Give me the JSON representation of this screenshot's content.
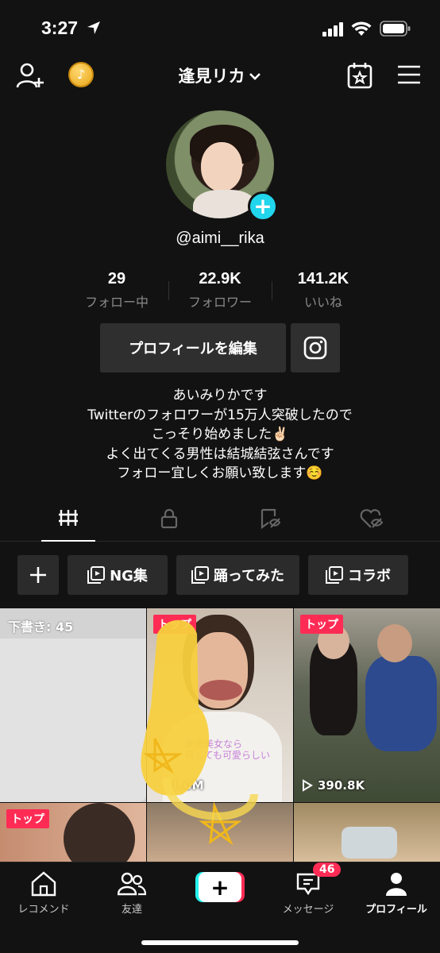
{
  "status_bar": {
    "time": "3:27"
  },
  "header": {
    "account_name": "逢見リカ"
  },
  "profile": {
    "username": "@aimi__rika",
    "stats": [
      {
        "value": "29",
        "label": "フォロー中"
      },
      {
        "value": "22.9K",
        "label": "フォロワー"
      },
      {
        "value": "141.2K",
        "label": "いいね"
      }
    ],
    "edit_button": "プロフィールを編集",
    "bio_lines": [
      "あいみりかです",
      "Twitterのフォロワーが15万人突破したので",
      "こっそり始めました✌🏻",
      "よく出てくる男性は結城結弦さんです",
      "フォロー宜しくお願い致します☺️"
    ]
  },
  "playlists": [
    {
      "label": "NG集"
    },
    {
      "label": "踊ってみた"
    },
    {
      "label": "コラボ"
    }
  ],
  "videos": [
    {
      "draft_label": "下書き: 45"
    },
    {
      "badge": "トップ",
      "views": "1.0M",
      "caption": "美男美女なら\n何しても可愛らしい"
    },
    {
      "badge": "トップ",
      "views": "390.8K"
    },
    {
      "badge": "トップ"
    }
  ],
  "tabbar": {
    "items": [
      {
        "label": "レコメンド"
      },
      {
        "label": "友達"
      },
      {
        "label": ""
      },
      {
        "label": "メッセージ",
        "badge": "46"
      },
      {
        "label": "プロフィール"
      }
    ]
  },
  "colors": {
    "accent_red": "#fe2c55",
    "accent_cyan": "#20d5ec",
    "background": "#121212"
  }
}
